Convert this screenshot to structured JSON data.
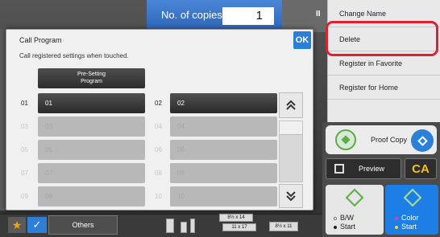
{
  "header": {
    "copies_label": "No. of copies",
    "copies_value": "1",
    "strip_label": "II"
  },
  "right_menu": {
    "items": [
      "Change Name",
      "Delete",
      "Register in Favorite",
      "Register for Home"
    ]
  },
  "proof_copy": {
    "label": "Proof Copy"
  },
  "preview": {
    "label": "Preview"
  },
  "ca": {
    "label": "CA"
  },
  "start_bw": {
    "line1": "B/W",
    "line2": "Start"
  },
  "start_color": {
    "line1": "Color",
    "line2": "Start"
  },
  "bottom_bar": {
    "others_label": "Others",
    "star_icon": "★",
    "check_icon": "✓"
  },
  "trays": [
    {
      "label": "8½ x 14"
    },
    {
      "label": "11 x 17"
    },
    {
      "label": "8½ x 11"
    }
  ],
  "dialog": {
    "title": "Call Program",
    "subtitle": "Call registered settings when touched.",
    "ok_label": "OK",
    "presetting_line1": "Pre-Setting",
    "presetting_line2": "Program",
    "rows": [
      {
        "num": "01",
        "label": "01"
      },
      {
        "num": "02",
        "label": "02"
      },
      {
        "num": "03",
        "label": "03"
      },
      {
        "num": "04",
        "label": "04"
      },
      {
        "num": "05",
        "label": "05"
      },
      {
        "num": "06",
        "label": "06"
      },
      {
        "num": "07",
        "label": "07"
      },
      {
        "num": "08",
        "label": "08"
      },
      {
        "num": "09",
        "label": "09"
      },
      {
        "num": "10",
        "label": "10"
      }
    ]
  },
  "colors": {
    "accent_blue": "#2a7fd8",
    "highlight_red": "#e02030",
    "ca_yellow": "#f3c30f"
  }
}
